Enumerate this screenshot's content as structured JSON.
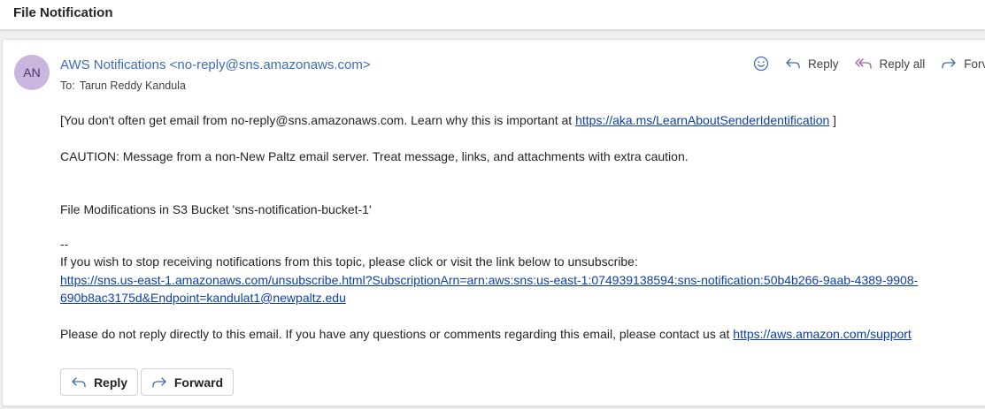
{
  "subject": "File Notification",
  "message": {
    "avatar_initials": "AN",
    "sender": "AWS Notifications <no-reply@sns.amazonaws.com>",
    "to_label": "To:",
    "to_name": "Tarun Reddy Kandula",
    "actions": {
      "reply": "Reply",
      "reply_all": "Reply all",
      "forward_partial": "Forv"
    },
    "body": {
      "notice_text": "[You don't often get email from no-reply@sns.amazonaws.com. Learn why this is important at ",
      "notice_link": "https://aka.ms/LearnAboutSenderIdentification",
      "notice_end": " ]",
      "caution": "CAUTION: Message from a non-New Paltz email server. Treat message, links, and attachments with extra caution.",
      "modifications": "File Modifications in S3 Bucket 'sns-notification-bucket-1'",
      "separator": "--",
      "unsubscribe_intro": "If you wish to stop receiving notifications from this topic, please click or visit the link below to unsubscribe:",
      "unsubscribe_link_line1": "https://sns.us-east-1.amazonaws.com/unsubscribe.html?SubscriptionArn=arn:aws:sns:us-east-1:074939138594:sns-notification:50b4b266-9aab-4389-9908-",
      "unsubscribe_link_line2": "690b8ac3175d&Endpoint=kandulat1@newpaltz.edu",
      "support_text": "Please do not reply directly to this email. If you have any questions or comments regarding this email, please contact us at ",
      "support_link": "https://aws.amazon.com/support"
    },
    "buttons": {
      "reply": "Reply",
      "forward": "Forward"
    }
  },
  "colors": {
    "avatar_bg": "#c9b5de",
    "sender": "#3d6cb3",
    "link": "#0b3fa8",
    "icon_accent": "#3d6cb3"
  },
  "icons": {
    "emoji": "smiley-icon",
    "reply": "reply-arrow-icon",
    "reply_all": "reply-all-icon",
    "forward": "forward-arrow-icon"
  }
}
